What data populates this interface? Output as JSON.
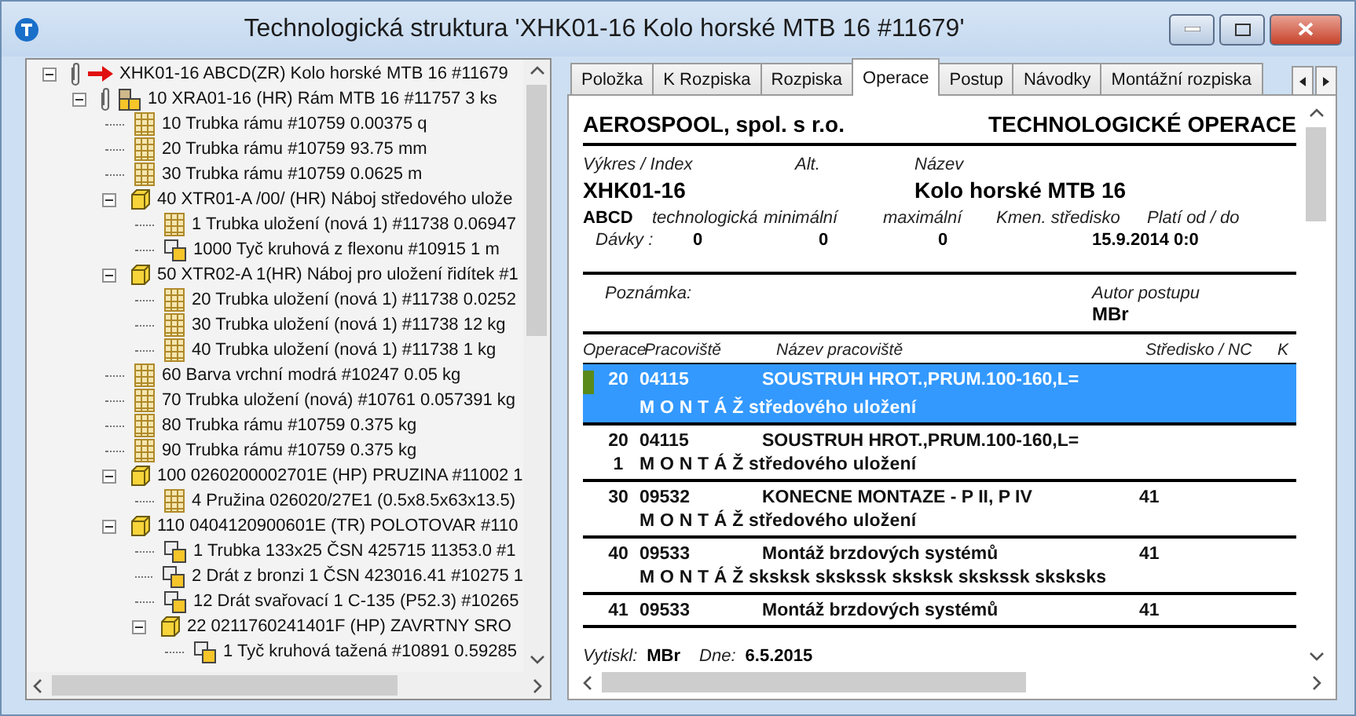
{
  "window": {
    "title": "Technologická struktura 'XHK01-16 Kolo horské MTB 16 #11679'"
  },
  "tree": [
    {
      "label": "XHK01-16 ABCD(ZR) Kolo horské MTB 16 #11679",
      "kind": "root",
      "attached": true,
      "expanded": true,
      "children": [
        {
          "label": "10 XRA01-16 (HR) Rám MTB 16 #11757 3 ks",
          "kind": "assembly",
          "attached": true,
          "expanded": true,
          "children": [
            {
              "label": "10 Trubka rámu #10759 0.00375 q",
              "kind": "material"
            },
            {
              "label": "20 Trubka rámu #10759 93.75 mm",
              "kind": "material"
            },
            {
              "label": "30 Trubka rámu #10759 0.0625 m",
              "kind": "material"
            },
            {
              "label": "40 XTR01-A /00/ (HR) Náboj středového ulože",
              "kind": "semi",
              "expanded": true,
              "children": [
                {
                  "label": "1 Trubka uložení (nová 1) #11738 0.06947",
                  "kind": "material"
                },
                {
                  "label": "1000 Tyč kruhová z flexonu #10915 1 m",
                  "kind": "purchased"
                }
              ]
            },
            {
              "label": "50 XTR02-A 1(HR) Náboj pro uložení řidítek #1",
              "kind": "semi",
              "expanded": true,
              "children": [
                {
                  "label": "20 Trubka uložení (nová 1) #11738 0.0252",
                  "kind": "material"
                },
                {
                  "label": "30 Trubka uložení (nová 1) #11738 12 kg",
                  "kind": "material"
                },
                {
                  "label": "40 Trubka uložení (nová 1) #11738 1 kg",
                  "kind": "material"
                }
              ]
            },
            {
              "label": "60 Barva vrchní modrá #10247 0.05 kg",
              "kind": "material"
            },
            {
              "label": "70 Trubka uložení (nová) #10761 0.057391 kg",
              "kind": "material"
            },
            {
              "label": "80 Trubka rámu #10759 0.375 kg",
              "kind": "material"
            },
            {
              "label": "90 Trubka rámu #10759 0.375 kg",
              "kind": "material"
            },
            {
              "label": "100 0260200002701E (HP) PRUZINA #11002 1",
              "kind": "semi",
              "expanded": true,
              "children": [
                {
                  "label": "4 Pružina 026020/27E1 (0.5x8.5x63x13.5)",
                  "kind": "material"
                }
              ]
            },
            {
              "label": "110 0404120900601E (TR) POLOTOVAR #110",
              "kind": "semi",
              "expanded": true,
              "children": [
                {
                  "label": "1 Trubka 133x25 ČSN 425715 11353.0 #1",
                  "kind": "purchased"
                },
                {
                  "label": "2 Drát z bronzi 1 ČSN 423016.41 #10275 1",
                  "kind": "purchased"
                },
                {
                  "label": "12 Drát svařovací 1 C-135 (P52.3) #10265",
                  "kind": "purchased"
                },
                {
                  "label": "22 0211760241401F (HP) ZAVRTNY SRO",
                  "kind": "semi",
                  "expanded": true,
                  "children": [
                    {
                      "label": "1 Tyč kruhová tažená #10891 0.59285",
                      "kind": "purchased"
                    }
                  ]
                }
              ]
            }
          ]
        }
      ]
    }
  ],
  "tabs": [
    {
      "label": "Položka",
      "selected": false
    },
    {
      "label": "K Rozpiska",
      "selected": false
    },
    {
      "label": "Rozpiska",
      "selected": false
    },
    {
      "label": "Operace",
      "selected": true
    },
    {
      "label": "Postup",
      "selected": false
    },
    {
      "label": "Návodky",
      "selected": false
    },
    {
      "label": "Montážní rozpiska",
      "selected": false
    }
  ],
  "report": {
    "company": "AEROSPOOL, spol. s r.o.",
    "heading": "TECHNOLOGICKÉ OPERACE",
    "drawing_label": "Výkres / Index",
    "alt_label": "Alt.",
    "name_label": "Název",
    "drawing": "XHK01-16",
    "name": "Kolo horské MTB 16",
    "variant": "ABCD",
    "batch_labels": [
      "technologická",
      "minimální",
      "maximální",
      "Kmen. středisko",
      "Platí od / do"
    ],
    "batch_title": "Dávky :",
    "batch_values": [
      "0",
      "0",
      "0"
    ],
    "valid": "15.9.2014 0:0",
    "note_label": "Poznámka:",
    "author_label": "Autor postupu",
    "author": "MBr",
    "columns": [
      "Operace",
      "Pracoviště",
      "Název pracoviště",
      "Středisko / NC",
      "K"
    ],
    "rows": [
      {
        "op": "20",
        "workplace": "04115",
        "name": "SOUSTRUH HROT.,PRUM.100-160,L=",
        "description": "M O N T Á Ž středového uložení",
        "selected": true
      },
      {
        "op": "20",
        "sub": "1",
        "workplace": "04115",
        "name": "SOUSTRUH HROT.,PRUM.100-160,L=",
        "description": "M O N T Á Ž středového uložení",
        "selected": false
      },
      {
        "op": "30",
        "workplace": "09532",
        "name": "KONECNE MONTAZE - P II, P IV",
        "center": "41",
        "description": "M O N T Á Ž středového uložení",
        "selected": false
      },
      {
        "op": "40",
        "workplace": "09533",
        "name": "Montáž brzdových systémů",
        "center": "41",
        "description": "M O N T Á Ž sksksk skskssk sksksk skskssk sksksks",
        "selected": false
      },
      {
        "op": "41",
        "workplace": "09533",
        "name": "Montáž brzdových systémů",
        "center": "41",
        "selected": false
      }
    ],
    "printed_label": "Vytiskl:",
    "printed_by": "MBr",
    "date_label": "Dne:",
    "date": "6.5.2015"
  }
}
